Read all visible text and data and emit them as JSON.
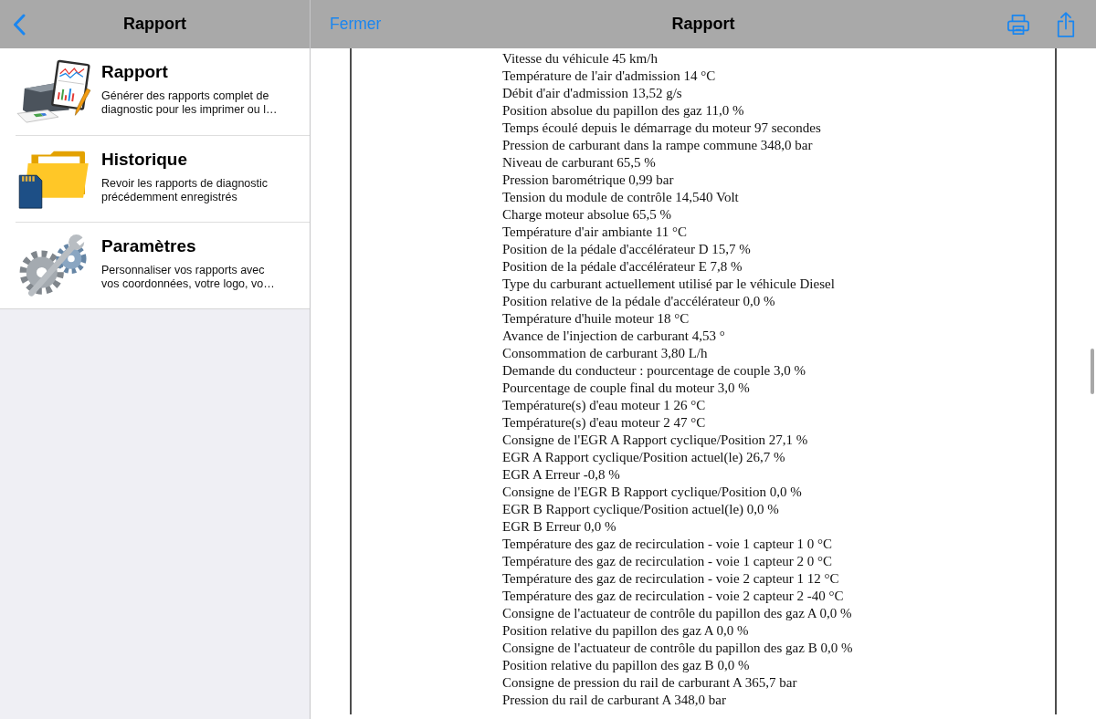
{
  "master": {
    "nav_bar": {
      "title": "Rapport"
    },
    "items": [
      {
        "title": "Rapport",
        "description": "Générer des rapports complet de diagnostic pour les imprimer ou l…",
        "selected": false
      },
      {
        "title": "Historique",
        "description": "Revoir les rapports de diagnostic précédemment enregistrés",
        "selected": false
      },
      {
        "title": "Paramètres",
        "description": "Personnaliser vos rapports avec vos coordonnées, votre logo, vo…",
        "selected": false
      }
    ]
  },
  "detail": {
    "nav_bar": {
      "close_button": "Fermer",
      "title": "Rapport"
    },
    "report_lines": [
      "Vitesse du véhicule 45 km/h",
      "Température de l'air d'admission 14 °C",
      "Débit d'air d'admission 13,52 g/s",
      "Position absolue du papillon des gaz 11,0 %",
      "Temps écoulé depuis le démarrage du moteur 97 secondes",
      "Pression de carburant dans la rampe commune 348,0 bar",
      "Niveau de carburant 65,5 %",
      "Pression barométrique 0,99 bar",
      "Tension du module de contrôle 14,540 Volt",
      "Charge moteur absolue 65,5 %",
      "Température d'air ambiante 11 °C",
      "Position de la pédale d'accélérateur D 15,7 %",
      "Position de la pédale d'accélérateur E 7,8 %",
      "Type du carburant actuellement utilisé par le véhicule Diesel",
      "Position relative de la pédale d'accélérateur 0,0 %",
      "Température d'huile moteur 18 °C",
      "Avance de l'injection de carburant 4,53 °",
      "Consommation de carburant 3,80 L/h",
      "Demande du conducteur : pourcentage de couple 3,0 %",
      "Pourcentage de couple final du moteur 3,0 %",
      "Température(s) d'eau moteur 1 26 °C",
      "Température(s) d'eau moteur 2 47 °C",
      "Consigne de l'EGR A Rapport cyclique/Position 27,1 %",
      "EGR A Rapport cyclique/Position actuel(le) 26,7 %",
      "EGR A Erreur -0,8 %",
      "Consigne de l'EGR B Rapport cyclique/Position 0,0 %",
      "EGR B Rapport cyclique/Position actuel(le) 0,0 %",
      "EGR B Erreur 0,0 %",
      "Température des gaz de recirculation - voie 1 capteur 1 0 °C",
      "Température des gaz de recirculation - voie 1 capteur 2 0 °C",
      "Température des gaz de recirculation - voie 2 capteur 1 12 °C",
      "Température des gaz de recirculation - voie 2 capteur 2 -40 °C",
      "Consigne de l'actuateur de contrôle du papillon des gaz A 0,0 %",
      "Position relative du papillon des gaz A 0,0 %",
      "Consigne de l'actuateur de contrôle du papillon des gaz B 0,0 %",
      "Position relative du papillon des gaz B 0,0 %",
      "Consigne de pression du rail de carburant A 365,7 bar",
      "Pression du rail de carburant A 348,0 bar"
    ]
  }
}
